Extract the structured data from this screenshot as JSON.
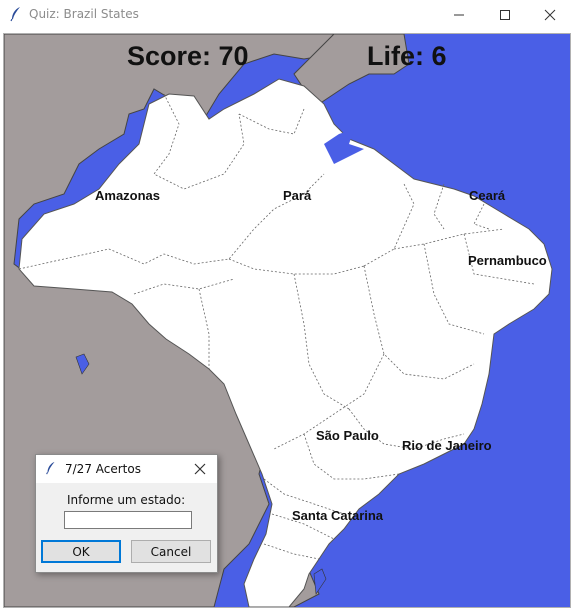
{
  "window": {
    "title": "Quiz: Brazil States",
    "icons": {
      "app": "feather-icon",
      "minimize": "minimize-icon",
      "maximize": "maximize-icon",
      "close": "close-icon"
    }
  },
  "game": {
    "score_text": "Score: 70",
    "life_text": "Life: 6"
  },
  "colors": {
    "ocean": "#4a5fe6",
    "land_brazil": "#ffffff",
    "neighbors": "#a39c9c",
    "borders": "#555555"
  },
  "states": [
    {
      "id": "amazonas",
      "label": "Amazonas"
    },
    {
      "id": "para",
      "label": "Pará"
    },
    {
      "id": "ceara",
      "label": "Ceará"
    },
    {
      "id": "pernambuco",
      "label": "Pernambuco"
    },
    {
      "id": "sao-paulo",
      "label": "São Paulo"
    },
    {
      "id": "rio-de-janeiro",
      "label": "Rio de Janeiro"
    },
    {
      "id": "santa-catarina",
      "label": "Santa Catarina"
    }
  ],
  "dialog": {
    "title": "7/27 Acertos",
    "prompt": "Informe um estado:",
    "input_value": "",
    "ok_label": "OK",
    "cancel_label": "Cancel"
  }
}
